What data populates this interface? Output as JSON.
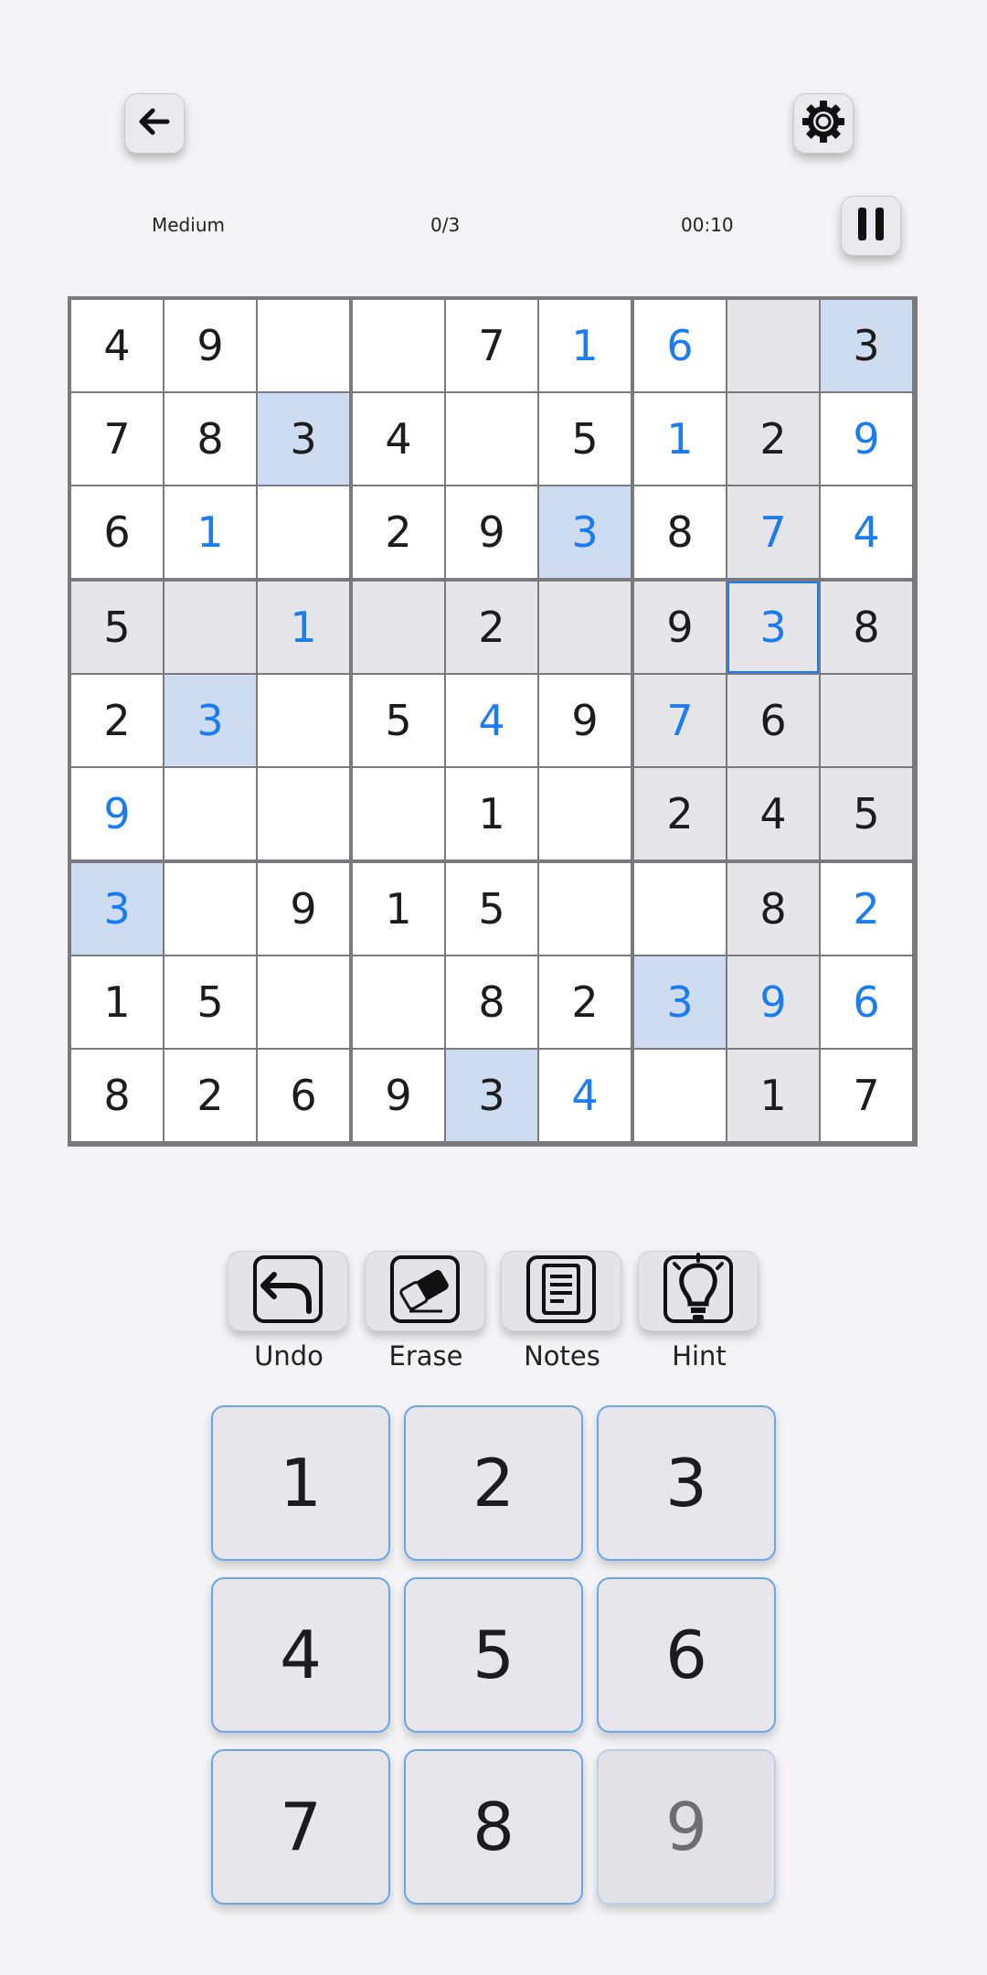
{
  "header": {
    "back_icon": "arrow-left-icon",
    "settings_icon": "gear-icon",
    "pause_icon": "pause-icon"
  },
  "status": {
    "difficulty": "Medium",
    "mistakes": "0/3",
    "timer": "00:10"
  },
  "board": {
    "rows": [
      [
        "4",
        "9",
        "",
        "",
        "7",
        "1",
        "6",
        "",
        "3"
      ],
      [
        "7",
        "8",
        "3",
        "4",
        "",
        "5",
        "1",
        "2",
        "9"
      ],
      [
        "6",
        "1",
        "",
        "2",
        "9",
        "3",
        "8",
        "7",
        "4"
      ],
      [
        "5",
        "",
        "1",
        "",
        "2",
        "",
        "9",
        "3",
        "8"
      ],
      [
        "2",
        "3",
        "",
        "5",
        "4",
        "9",
        "7",
        "6",
        ""
      ],
      [
        "9",
        "",
        "",
        "",
        "1",
        "",
        "2",
        "4",
        "5"
      ],
      [
        "3",
        "",
        "9",
        "1",
        "5",
        "",
        "",
        "8",
        "2"
      ],
      [
        "1",
        "5",
        "",
        "",
        "8",
        "2",
        "3",
        "9",
        "6"
      ],
      [
        "8",
        "2",
        "6",
        "9",
        "3",
        "4",
        "",
        "1",
        "7"
      ]
    ],
    "user_cells": [
      [
        0,
        5
      ],
      [
        0,
        6
      ],
      [
        1,
        6
      ],
      [
        1,
        8
      ],
      [
        2,
        1
      ],
      [
        2,
        5
      ],
      [
        2,
        7
      ],
      [
        2,
        8
      ],
      [
        3,
        2
      ],
      [
        3,
        7
      ],
      [
        4,
        1
      ],
      [
        4,
        4
      ],
      [
        4,
        6
      ],
      [
        5,
        0
      ],
      [
        6,
        0
      ],
      [
        6,
        8
      ],
      [
        7,
        6
      ],
      [
        7,
        7
      ],
      [
        7,
        8
      ],
      [
        8,
        5
      ]
    ],
    "selected": [
      3,
      7
    ],
    "same_number_cells": [
      [
        0,
        8
      ],
      [
        1,
        2
      ],
      [
        2,
        5
      ],
      [
        4,
        1
      ],
      [
        6,
        0
      ],
      [
        7,
        6
      ],
      [
        8,
        4
      ]
    ],
    "colors": {
      "given": "#1c1c1e",
      "user": "#1a7cf0",
      "related": "#e6e6ea",
      "same_number": "#cddcf0"
    }
  },
  "tools": [
    {
      "label": "Undo",
      "icon": "undo-icon"
    },
    {
      "label": "Erase",
      "icon": "eraser-icon"
    },
    {
      "label": "Notes",
      "icon": "notes-icon"
    },
    {
      "label": "Hint",
      "icon": "lightbulb-icon"
    }
  ],
  "numpad": [
    {
      "label": "1"
    },
    {
      "label": "2"
    },
    {
      "label": "3"
    },
    {
      "label": "4"
    },
    {
      "label": "5"
    },
    {
      "label": "6"
    },
    {
      "label": "7"
    },
    {
      "label": "8"
    },
    {
      "label": "9",
      "disabled": true
    }
  ]
}
